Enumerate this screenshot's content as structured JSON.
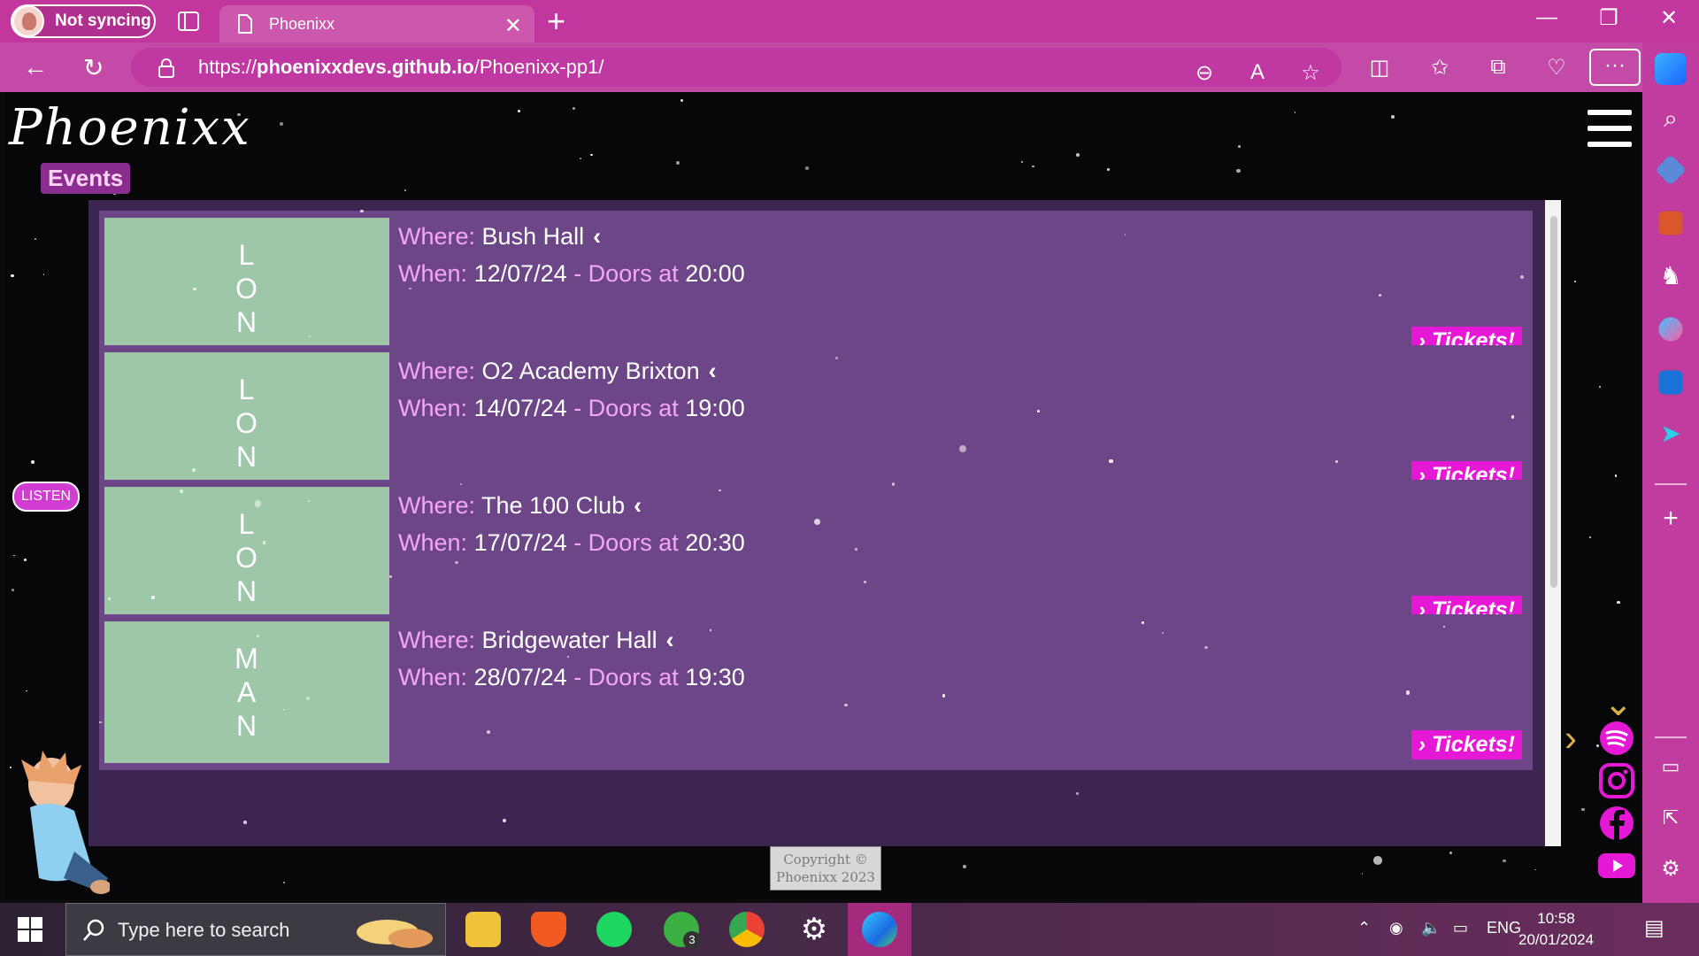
{
  "browser": {
    "profile_label": "Not syncing",
    "tab_title": "Phoenixx",
    "url_prefix": "https://",
    "url_domain": "phoenixxdevs.github.io",
    "url_path": "/Phoenixx-pp1/",
    "accent_color": "#c2379e"
  },
  "site": {
    "logo": "Phoenixx",
    "section_label": "Events",
    "listen_label": "LISTEN",
    "copyright_line1": "Copyright ©",
    "copyright_line2": "Phoenixx 2023",
    "where_label": "Where:",
    "when_label": "When:",
    "doors_label": "- Doors at",
    "tickets_label": "Tickets!"
  },
  "events": [
    {
      "city": [
        "L",
        "O",
        "N"
      ],
      "venue": "Bush Hall",
      "date": "12/07/24",
      "doors": "20:00"
    },
    {
      "city": [
        "L",
        "O",
        "N"
      ],
      "venue": "O2 Academy Brixton",
      "date": "14/07/24",
      "doors": "19:00"
    },
    {
      "city": [
        "L",
        "O",
        "N"
      ],
      "venue": "The 100 Club",
      "date": "17/07/24",
      "doors": "20:30"
    },
    {
      "city": [
        "M",
        "A",
        "N"
      ],
      "venue": "Bridgewater Hall",
      "date": "28/07/24",
      "doors": "19:30"
    }
  ],
  "social_icons": [
    "spotify-icon",
    "instagram-icon",
    "facebook-icon",
    "youtube-icon"
  ],
  "taskbar": {
    "search_placeholder": "Type here to search",
    "language": "ENG",
    "time": "10:58",
    "date": "20/01/2024",
    "xbox_badge": "3"
  }
}
